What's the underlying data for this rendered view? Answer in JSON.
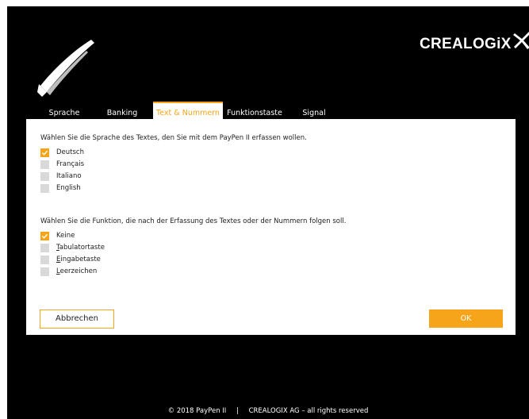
{
  "brand": {
    "name": "CREALOGiX"
  },
  "tabs": [
    {
      "label": "Sprache",
      "active": false
    },
    {
      "label": "Banking",
      "active": false
    },
    {
      "label": "Text & Nummern",
      "active": true
    },
    {
      "label": "Funktionstaste",
      "active": false
    },
    {
      "label": "Signal",
      "active": false
    }
  ],
  "language_section": {
    "question": "Wählen Sie die Sprache des Textes, den Sie mit dem PayPen II erfassen wollen.",
    "options": [
      {
        "label": "Deutsch",
        "checked": true
      },
      {
        "label": "Français",
        "checked": false
      },
      {
        "label": "Italiano",
        "checked": false
      },
      {
        "label": "English",
        "checked": false
      }
    ]
  },
  "function_section": {
    "question": "Wählen Sie die Funktion, die nach der Erfassung des Textes oder der Nummern folgen soll.",
    "options": [
      {
        "label": "Keine",
        "checked": true
      },
      {
        "label": "Tabulatortaste",
        "checked": false
      },
      {
        "label": "Eingabetaste",
        "checked": false
      },
      {
        "label": "Leerzeichen",
        "checked": false
      }
    ]
  },
  "buttons": {
    "cancel": "Abbrechen",
    "ok": "OK"
  },
  "footer": {
    "copyright": "© 2018 PayPen II",
    "separator": "|",
    "company": "CREALOGIX AG – all rights reserved"
  },
  "colors": {
    "accent": "#f6a51a",
    "background": "#000000",
    "panel": "#ffffff",
    "checkbox_off": "#d9d9d9"
  },
  "icons": {
    "logo": "paypen-pen-icon",
    "brand_mark": "crealogix-x-icon",
    "check": "checkmark-icon"
  }
}
